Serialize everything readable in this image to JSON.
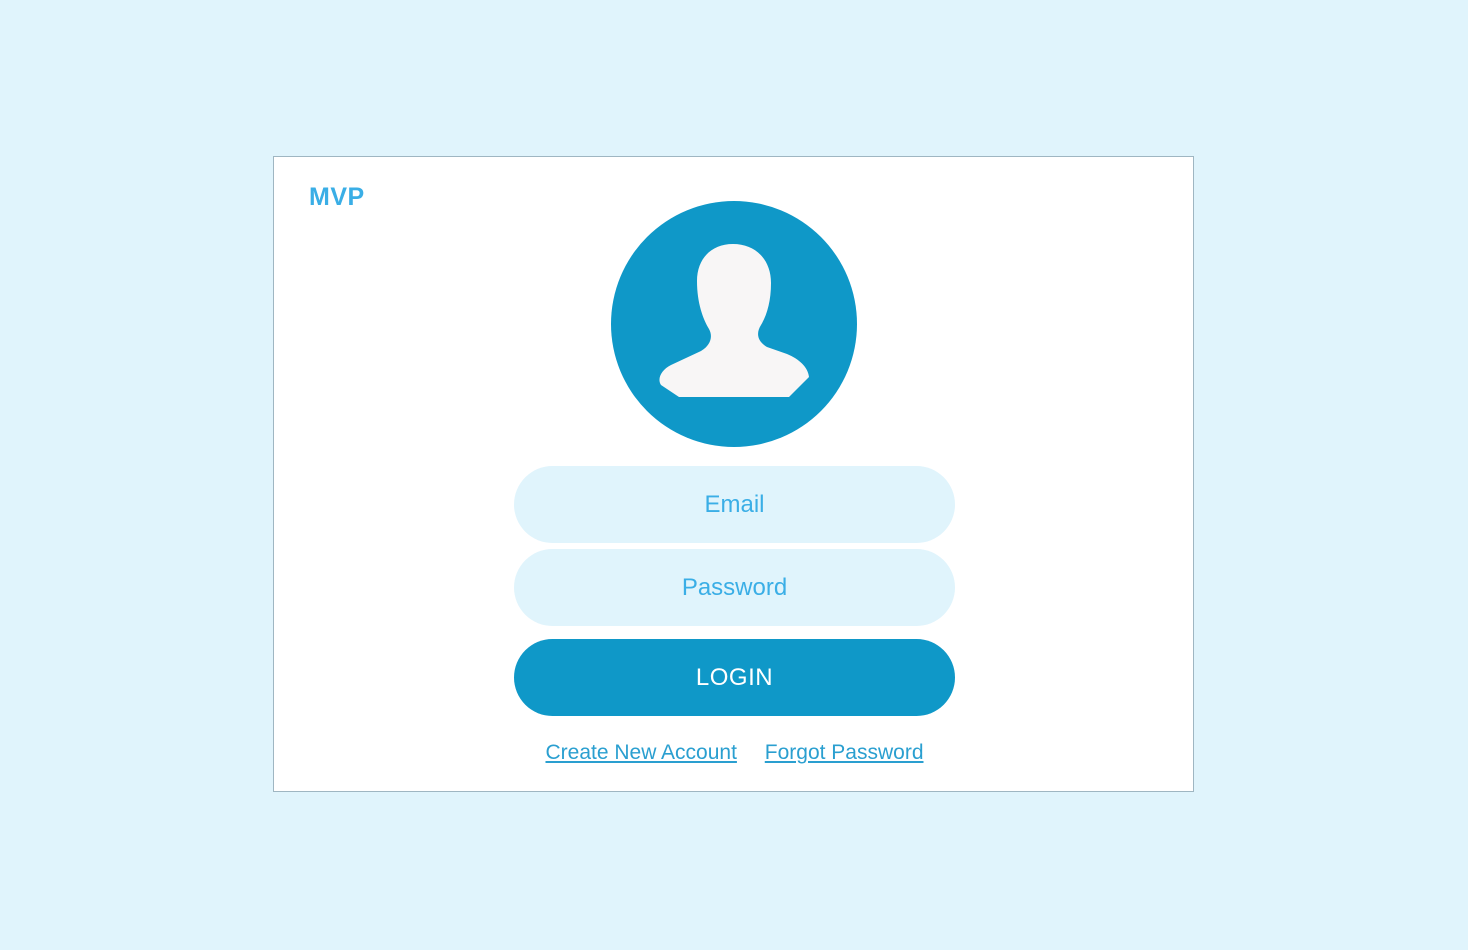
{
  "brand": {
    "name": "MVP"
  },
  "avatar": {
    "icon": "user-silhouette-icon"
  },
  "form": {
    "email_placeholder": "Email",
    "password_placeholder": "Password",
    "login_label": "LOGIN"
  },
  "links": {
    "create_account": "Create New Account",
    "forgot_password": "Forgot Password"
  },
  "colors": {
    "background": "#e0f4fc",
    "card": "#ffffff",
    "accent": "#0f98c8",
    "brand_text": "#3aaee6",
    "field_bg": "#e0f4fc",
    "link": "#2a9fd0"
  }
}
